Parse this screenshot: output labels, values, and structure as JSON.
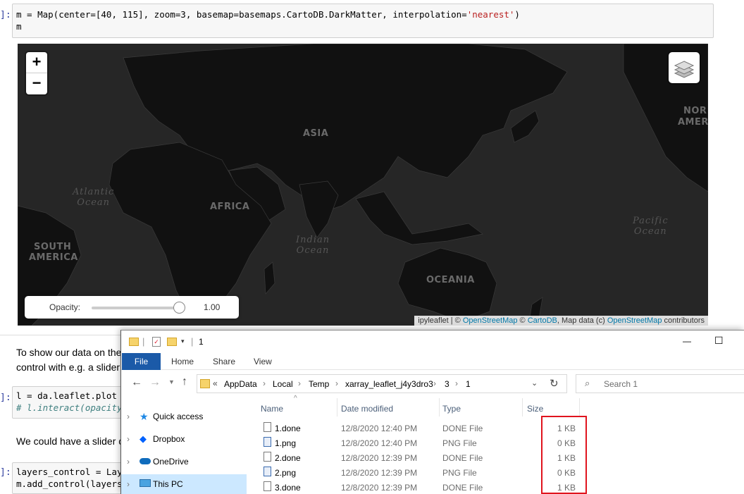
{
  "notebook": {
    "cell1": {
      "prompt": "]:",
      "line1_a": "m = Map(center=[40, 115], zoom=3, basemap=basemaps.CartoDB.DarkMatter, interpolation=",
      "line1_s": "'nearest'",
      "line1_b": ")",
      "line2": "m"
    },
    "text1_line1": "To show our data on the",
    "text1_line2": "control with e.g. a slider",
    "cell2": {
      "prompt": "]:",
      "line1": "l = da.leaflet.plot",
      "line2": "# l.interact(opacity"
    },
    "text2": "We could have a slider c",
    "cell3": {
      "prompt": "]:",
      "line1": "layers_control = Lay",
      "line2": "m.add_control(layers"
    }
  },
  "map": {
    "zoom_in": "+",
    "zoom_out": "−",
    "labels": {
      "asia": "ASIA",
      "africa": "AFRICA",
      "south_america_1": "SOUTH",
      "south_america_2": "AMERICA",
      "oceania": "OCEANIA",
      "north_america_1": "NOR",
      "north_america_2": "AMER"
    },
    "oceans": {
      "atlantic_1": "Atlantic",
      "atlantic_2": "Ocean",
      "indian_1": "Indian",
      "indian_2": "Ocean",
      "pacific_1": "Pacific",
      "pacific_2": "Ocean"
    },
    "opacity": {
      "label": "Opacity:",
      "value": "1.00",
      "level": 1.0
    },
    "attribution": {
      "prefix": "ipyleaflet | © ",
      "osm": "OpenStreetMap",
      "sep": " © ",
      "carto": "CartoDB",
      "mid": ", Map data (c) ",
      "osm2": "OpenStreetMap",
      "suffix": " contributors"
    }
  },
  "explorer": {
    "title_number": "1",
    "title_sep": "|",
    "window_buttons": {
      "minimize": "—",
      "maximize": "☐"
    },
    "ribbon_tabs": [
      "File",
      "Home",
      "Share",
      "View"
    ],
    "breadcrumb": [
      "AppData",
      "Local",
      "Temp",
      "xarray_leaflet_j4y3dro3",
      "3",
      "1"
    ],
    "breadcrumb_prefix": "«",
    "search_placeholder": "Search 1",
    "nav": [
      {
        "label": "Quick access",
        "icon": "star-icon"
      },
      {
        "label": "Dropbox",
        "icon": "dropbox-icon"
      },
      {
        "label": "OneDrive",
        "icon": "cloud-icon"
      },
      {
        "label": "This PC",
        "icon": "computer-icon"
      }
    ],
    "columns": [
      "Name",
      "Date modified",
      "Type",
      "Size"
    ],
    "files": [
      {
        "name": "1.done",
        "date": "12/8/2020 12:40 PM",
        "type": "DONE File",
        "size": "1 KB"
      },
      {
        "name": "1.png",
        "date": "12/8/2020 12:40 PM",
        "type": "PNG File",
        "size": "0 KB"
      },
      {
        "name": "2.done",
        "date": "12/8/2020 12:39 PM",
        "type": "DONE File",
        "size": "1 KB"
      },
      {
        "name": "2.png",
        "date": "12/8/2020 12:39 PM",
        "type": "PNG File",
        "size": "0 KB"
      },
      {
        "name": "3.done",
        "date": "12/8/2020 12:39 PM",
        "type": "DONE File",
        "size": "1 KB"
      }
    ],
    "colors": {
      "ribbon_file": "#1b5aa8",
      "selected": "#cce8ff",
      "highlight": "#e0141e"
    }
  }
}
